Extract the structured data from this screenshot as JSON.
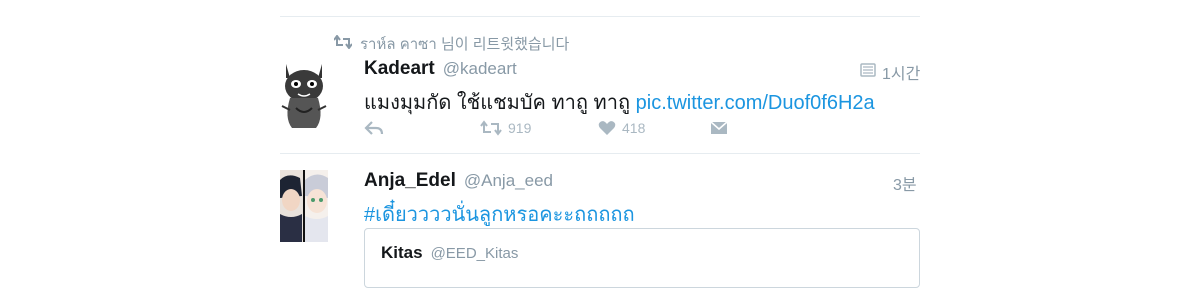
{
  "retweet_notice": {
    "text": "ราห์ล คาซา 님이 리트윗했습니다"
  },
  "tweet1": {
    "display_name": "Kadeart",
    "handle": "@kadeart",
    "time": "1시간",
    "text": "แมงมุมกัด ใช้แชมบัค ทาถู ทาถู",
    "link": "pic.twitter.com/Duof0f6H2a",
    "retweets": "919",
    "likes": "418"
  },
  "tweet2": {
    "display_name": "Anja_Edel",
    "handle": "@Anja_eed",
    "time": "3분",
    "text": "#เดี๋ยววววนั่นลูกหรอคะะถถถถถ",
    "quote": {
      "display_name": "Kitas",
      "handle": "@EED_Kitas"
    }
  },
  "colors": {
    "link": "#1b95e0",
    "muted": "#8899a6",
    "icon": "#aab8c2",
    "divider": "#e6ecf0"
  }
}
